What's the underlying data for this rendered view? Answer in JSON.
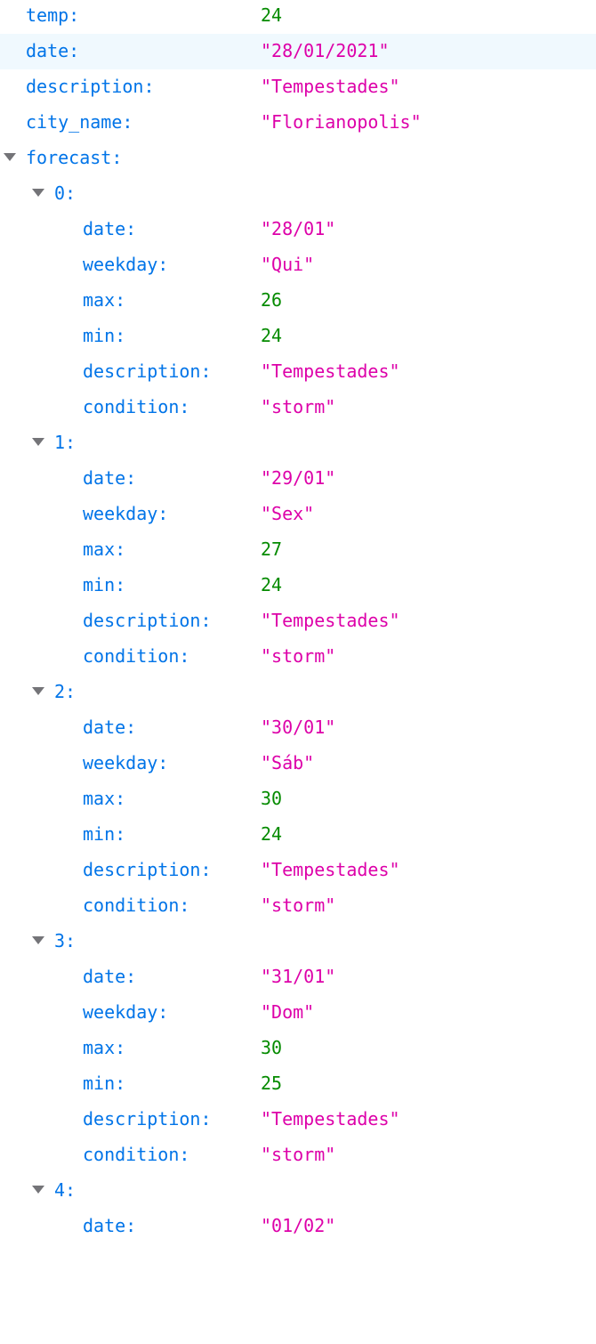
{
  "temp": {
    "key": "temp:",
    "value": "24"
  },
  "date": {
    "key": "date:",
    "value": "\"28/01/2021\""
  },
  "description": {
    "key": "description:",
    "value": "\"Tempestades\""
  },
  "city_name": {
    "key": "city_name:",
    "value": "\"Florianopolis\""
  },
  "forecast": {
    "key": "forecast:",
    "items": [
      {
        "index": "0:",
        "date": {
          "key": "date:",
          "value": "\"28/01\""
        },
        "weekday": {
          "key": "weekday:",
          "value": "\"Qui\""
        },
        "max": {
          "key": "max:",
          "value": "26"
        },
        "min": {
          "key": "min:",
          "value": "24"
        },
        "description": {
          "key": "description:",
          "value": "\"Tempestades\""
        },
        "condition": {
          "key": "condition:",
          "value": "\"storm\""
        }
      },
      {
        "index": "1:",
        "date": {
          "key": "date:",
          "value": "\"29/01\""
        },
        "weekday": {
          "key": "weekday:",
          "value": "\"Sex\""
        },
        "max": {
          "key": "max:",
          "value": "27"
        },
        "min": {
          "key": "min:",
          "value": "24"
        },
        "description": {
          "key": "description:",
          "value": "\"Tempestades\""
        },
        "condition": {
          "key": "condition:",
          "value": "\"storm\""
        }
      },
      {
        "index": "2:",
        "date": {
          "key": "date:",
          "value": "\"30/01\""
        },
        "weekday": {
          "key": "weekday:",
          "value": "\"Sáb\""
        },
        "max": {
          "key": "max:",
          "value": "30"
        },
        "min": {
          "key": "min:",
          "value": "24"
        },
        "description": {
          "key": "description:",
          "value": "\"Tempestades\""
        },
        "condition": {
          "key": "condition:",
          "value": "\"storm\""
        }
      },
      {
        "index": "3:",
        "date": {
          "key": "date:",
          "value": "\"31/01\""
        },
        "weekday": {
          "key": "weekday:",
          "value": "\"Dom\""
        },
        "max": {
          "key": "max:",
          "value": "30"
        },
        "min": {
          "key": "min:",
          "value": "25"
        },
        "description": {
          "key": "description:",
          "value": "\"Tempestades\""
        },
        "condition": {
          "key": "condition:",
          "value": "\"storm\""
        }
      },
      {
        "index": "4:",
        "date": {
          "key": "date:",
          "value": "\"01/02\""
        }
      }
    ]
  },
  "colors": {
    "key": "#0074e8",
    "string": "#dd00a9",
    "number": "#058b00",
    "twisty": "#747478",
    "row_highlight": "#f0f9fe"
  },
  "icons": {
    "expand": "triangle-down-icon"
  }
}
